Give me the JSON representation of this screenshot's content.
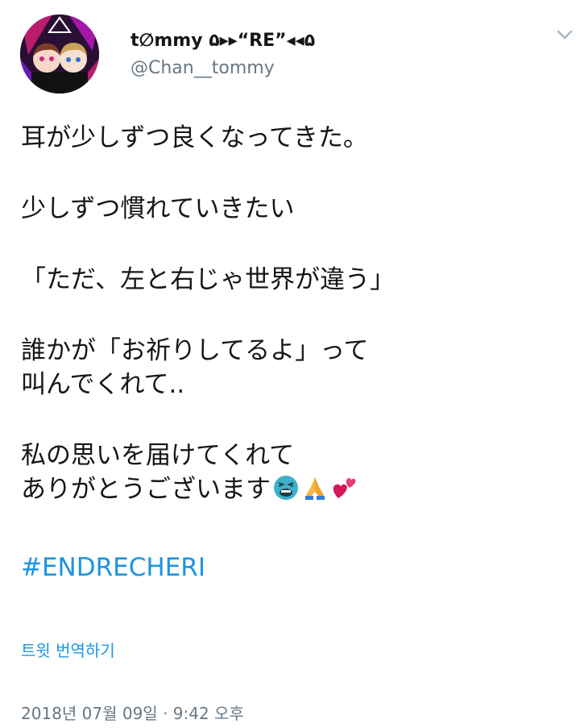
{
  "author": {
    "display_name": "t∅mmy ۵▸▸“RE”◂◂۵",
    "handle": "@Chan__tommy"
  },
  "icons": {
    "avatar": "avatar-image",
    "menu": "chevron-down-icon",
    "emoji_1": "tired-face-emoji",
    "emoji_2": "folded-hands-emoji",
    "emoji_3": "two-hearts-emoji"
  },
  "tweet": {
    "lines_p1": [
      "耳が少しずつ良くなってきた。"
    ],
    "lines_p2": [
      "少しずつ慣れていきたい"
    ],
    "lines_p3": [
      "「ただ、左と右じゃ世界が違う」"
    ],
    "lines_p4": [
      "誰かが「お祈りしてるよ」って",
      "叫んでくれて.."
    ],
    "lines_p5": [
      "私の思いを届けてくれて",
      "ありがとうございます"
    ],
    "hashtag": "#ENDRECHERI"
  },
  "footer": {
    "translate_label": "트윗 번역하기",
    "timestamp": "2018년 07월 09일 · 9:42 오후"
  },
  "colors": {
    "link": "#1b95e0",
    "muted": "#657786",
    "text": "#14171a"
  }
}
